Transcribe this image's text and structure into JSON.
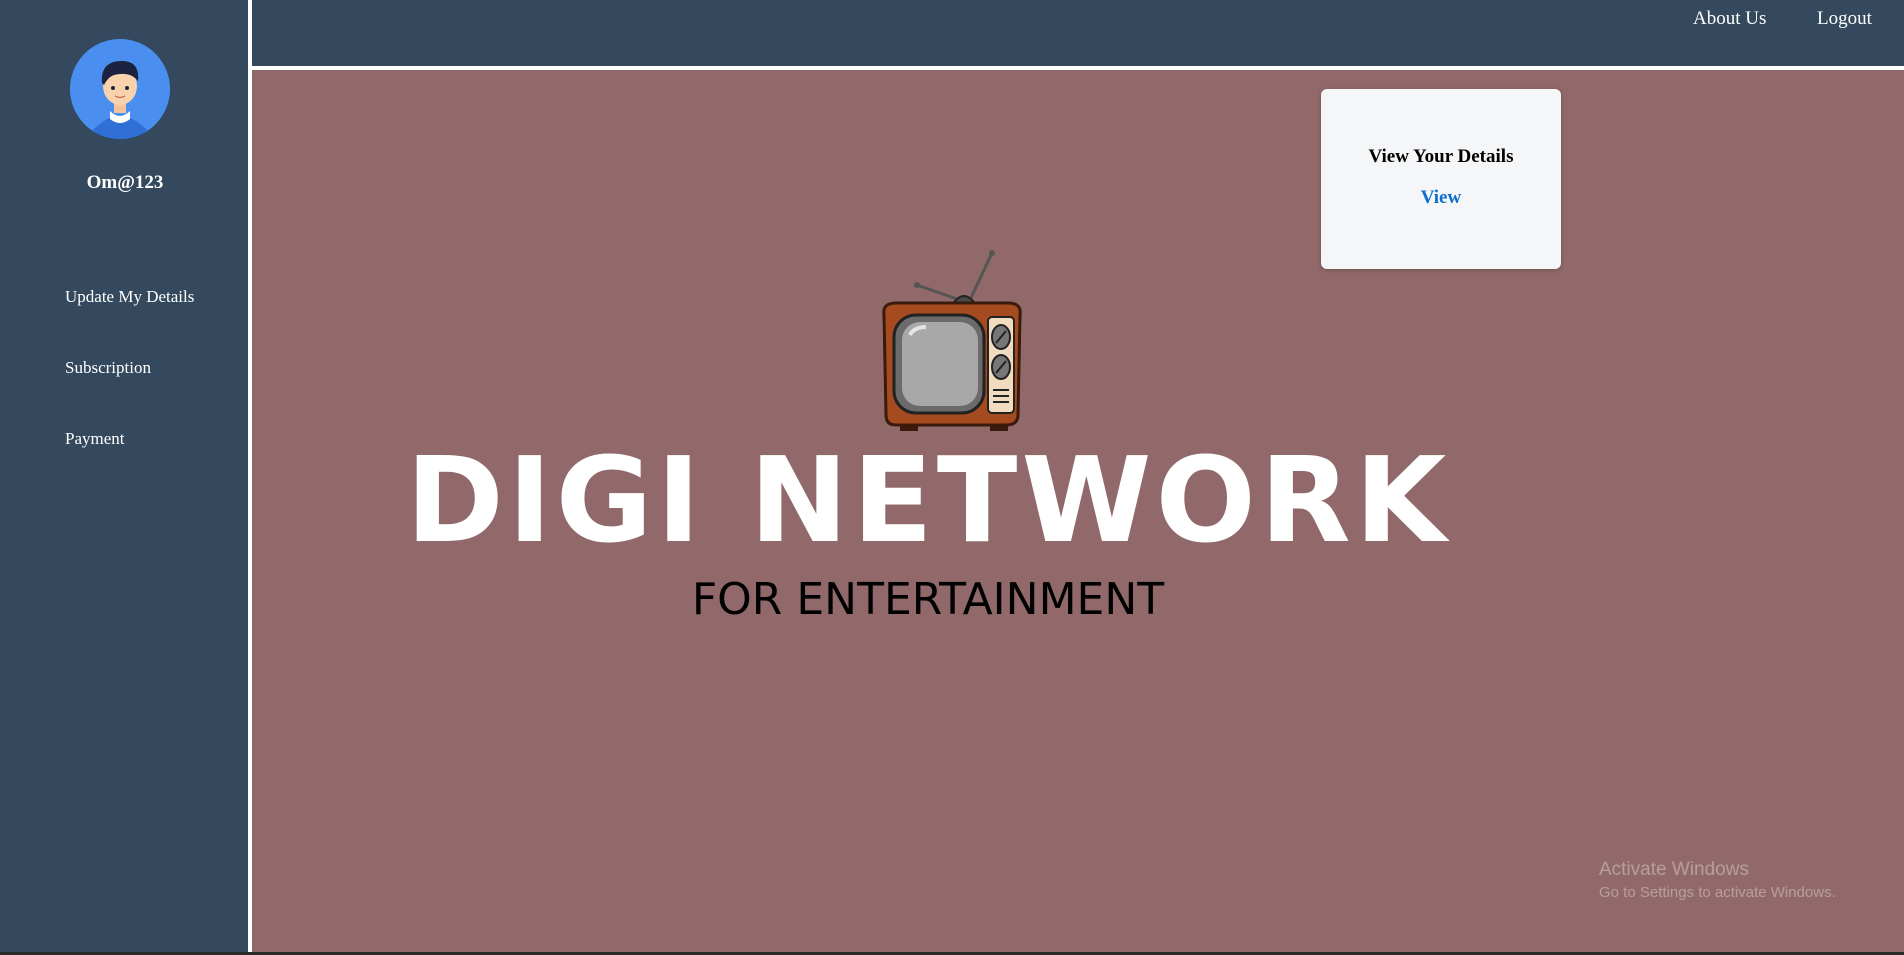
{
  "sidebar": {
    "username": "Om@123",
    "avatar_icon": "user-avatar-icon",
    "items": [
      {
        "label": "Update My Details"
      },
      {
        "label": "Subscription"
      },
      {
        "label": "Payment"
      }
    ]
  },
  "topbar": {
    "about_label": "About Us",
    "logout_label": "Logout"
  },
  "card": {
    "title": "View Your Details",
    "link_label": "View"
  },
  "brand": {
    "title": "DIGI NETWORK",
    "subtitle": "FOR ENTERTAINMENT",
    "logo_icon": "retro-tv-icon"
  },
  "watermark": {
    "line1": "Activate Windows",
    "line2": "Go to Settings to activate Windows."
  },
  "colors": {
    "sidebar_bg": "#34495e",
    "main_bg": "#91696a",
    "card_bg": "#f5f6f8",
    "link": "#0a6fd0",
    "avatar_bg": "#4a8ef0"
  }
}
